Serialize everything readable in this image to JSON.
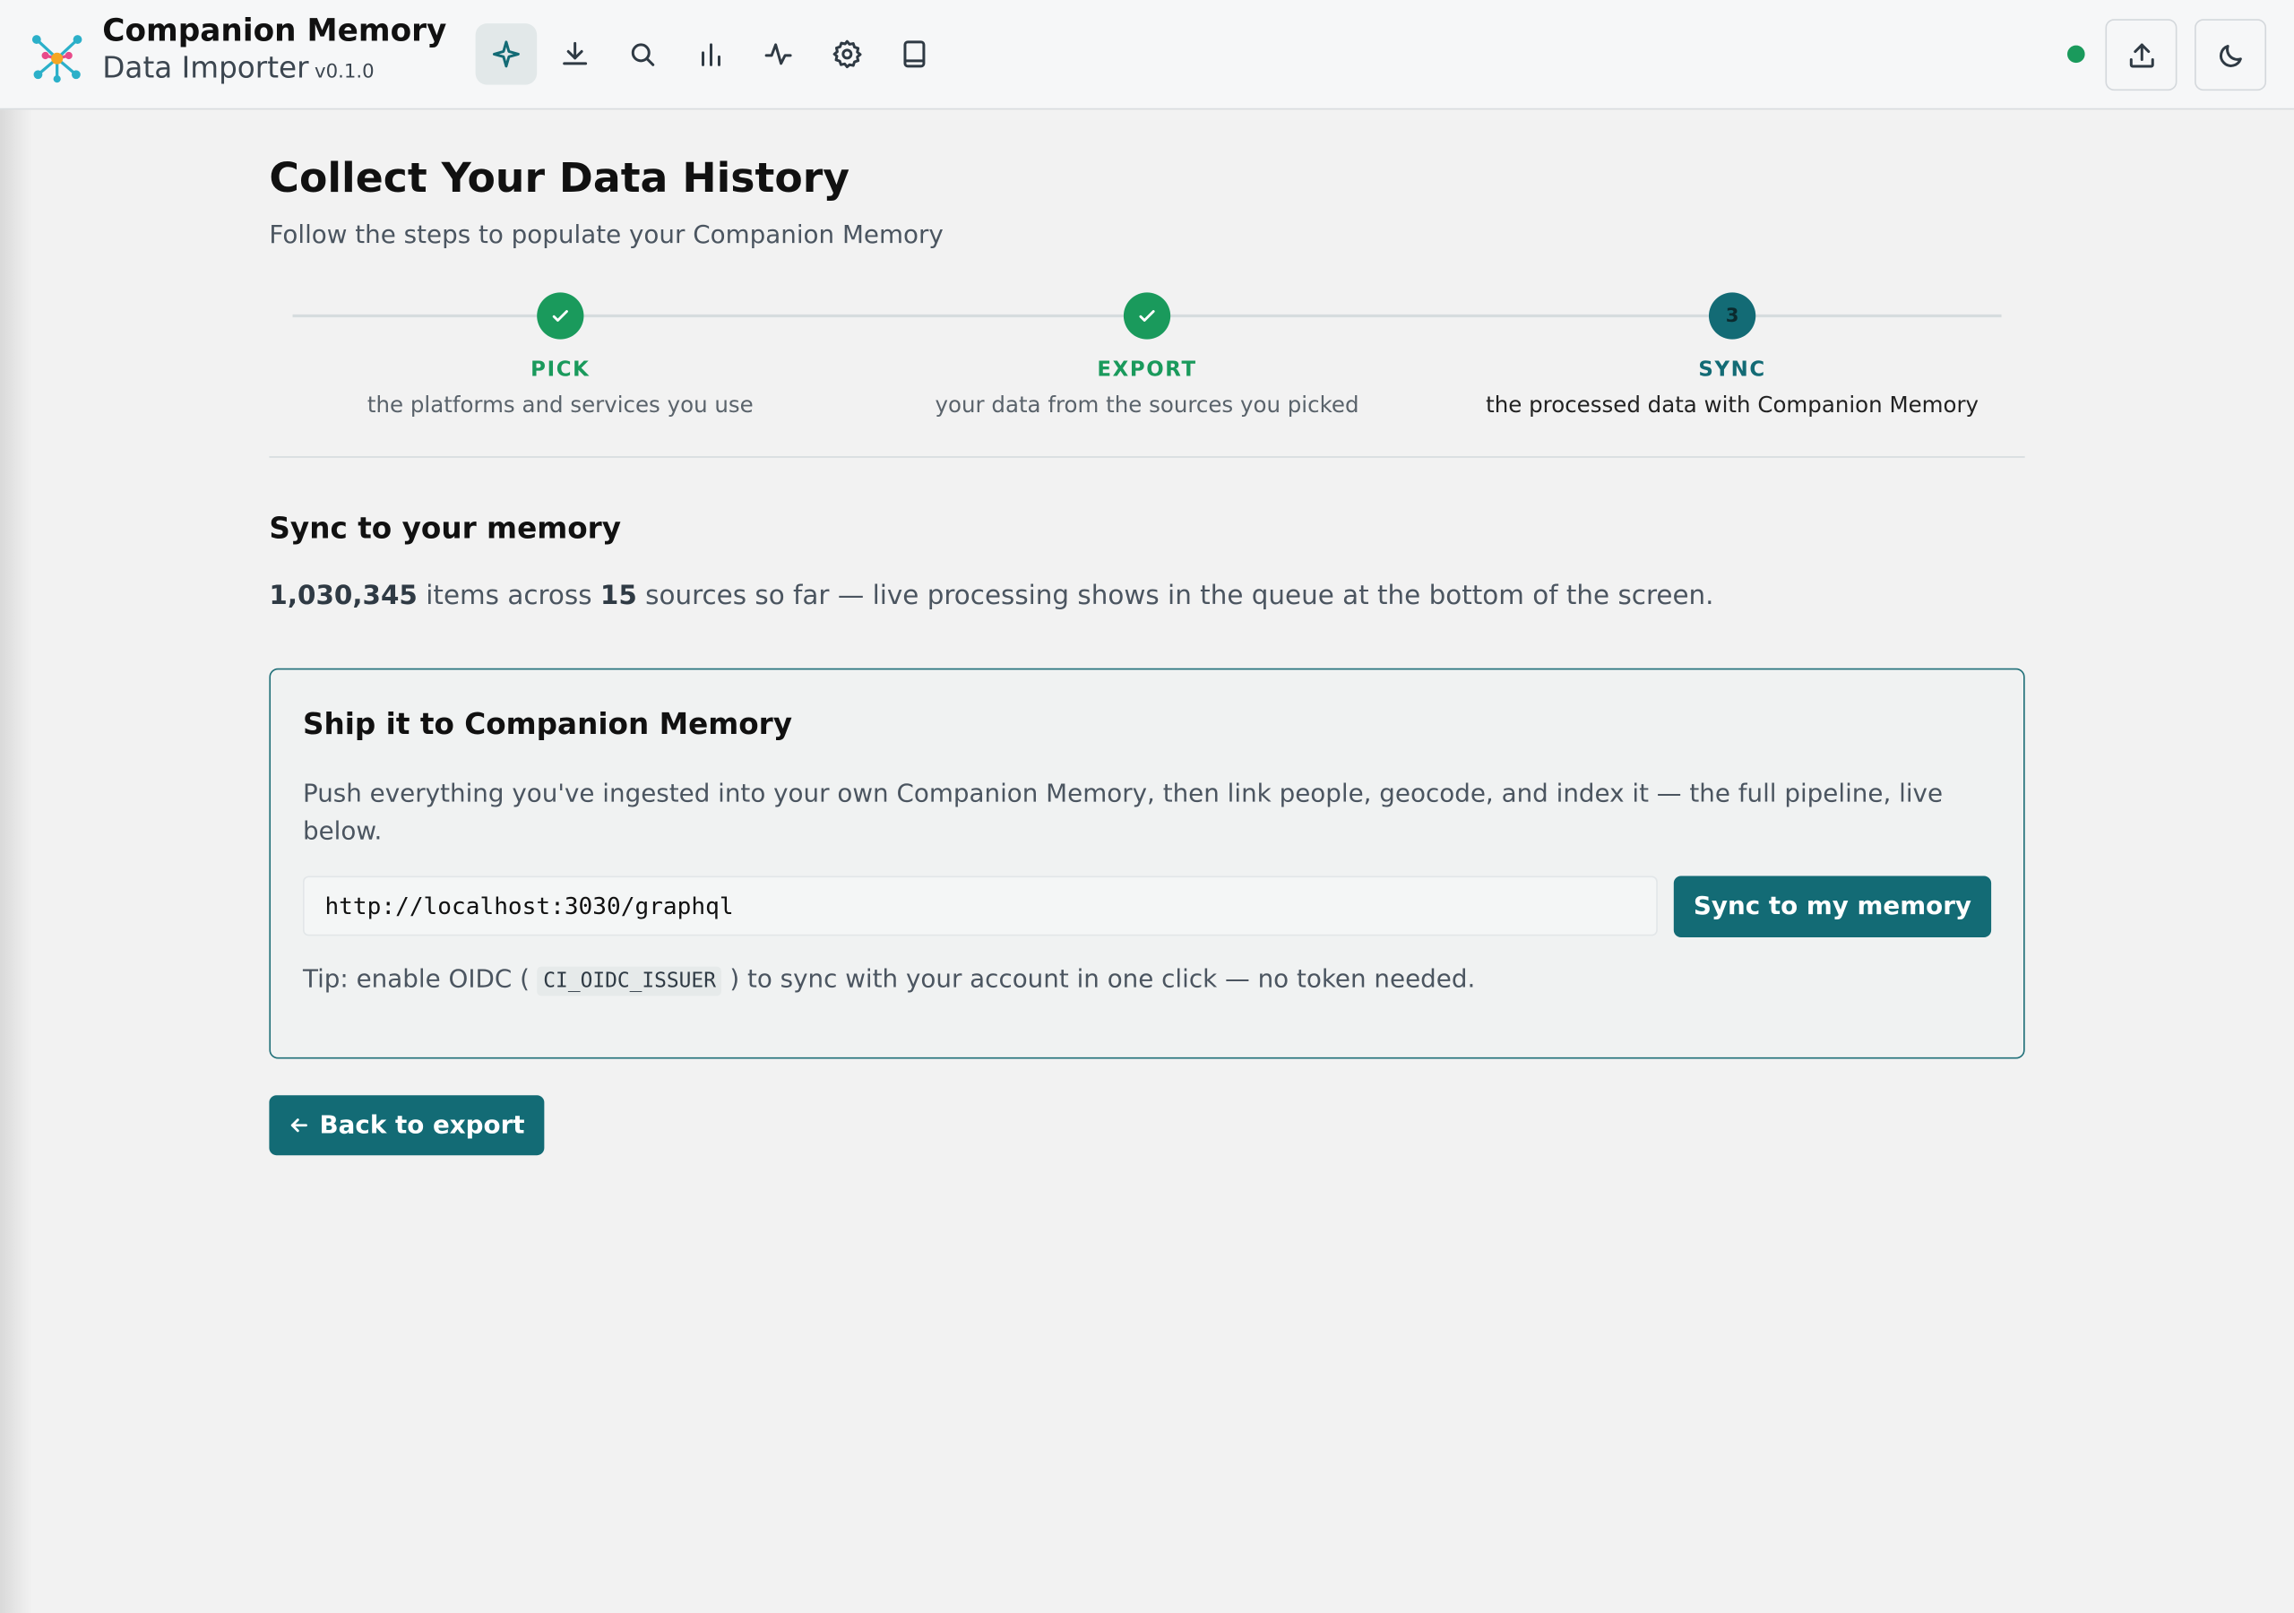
{
  "app": {
    "title": "Companion Memory",
    "subtitle": "Data Importer",
    "version": "v0.1.0"
  },
  "nav": {
    "icons": [
      "sparkle-icon",
      "download-icon",
      "search-icon",
      "bar-chart-icon",
      "activity-icon",
      "gear-icon",
      "book-icon"
    ],
    "active": "sparkle-icon"
  },
  "header_actions": {
    "status": "online",
    "upload_icon": "upload-icon",
    "theme_icon": "moon-icon"
  },
  "page": {
    "title": "Collect Your Data History",
    "subtitle": "Follow the steps to populate your Companion Memory"
  },
  "steps": [
    {
      "label": "PICK",
      "description": "the platforms and services you use",
      "state": "done"
    },
    {
      "label": "EXPORT",
      "description": "your data from the sources you picked",
      "state": "done"
    },
    {
      "number": "3",
      "label": "SYNC",
      "description": "the processed data with Companion Memory",
      "state": "current"
    }
  ],
  "section": {
    "title": "Sync to your memory",
    "items_count": "1,030,345",
    "items_text": "items across",
    "sources_count": "15",
    "sources_text": "sources so far — live processing shows in the queue at the bottom of the screen."
  },
  "card": {
    "title": "Ship it to Companion Memory",
    "description": "Push everything you've ingested into your own Companion Memory, then link people, geocode, and index it — the full pipeline, live below.",
    "endpoint_value": "http://localhost:3030/graphql",
    "sync_button": "Sync to my memory",
    "tip_before": "Tip: enable OIDC (",
    "tip_code": "CI_OIDC_ISSUER",
    "tip_after": ") to sync with your account in one click — no token needed."
  },
  "back_button": "Back to export",
  "colors": {
    "primary": "#136b75",
    "success": "#1a9a5c",
    "background": "#f2f2f2"
  }
}
